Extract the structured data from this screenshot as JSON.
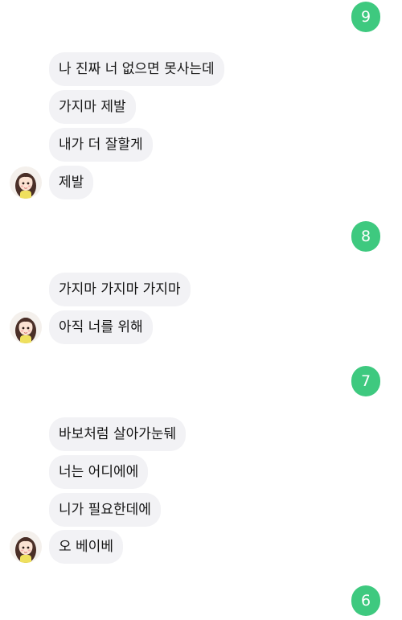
{
  "messages": [
    {
      "type": "sent",
      "text": "9"
    },
    {
      "type": "received",
      "text": "나 진짜 너 없으면 못사는데"
    },
    {
      "type": "received",
      "text": "가지마 제발"
    },
    {
      "type": "received",
      "text": "내가 더 잘할게"
    },
    {
      "type": "received",
      "text": "제발"
    },
    {
      "type": "sent",
      "text": "8"
    },
    {
      "type": "received",
      "text": "가지마 가지마 가지마"
    },
    {
      "type": "received",
      "text": "아직 너를 위해"
    },
    {
      "type": "sent",
      "text": "7"
    },
    {
      "type": "received",
      "text": "바보처럼 살아가눈뒈"
    },
    {
      "type": "received",
      "text": "너는 어디에에"
    },
    {
      "type": "received",
      "text": "니가 필요한데에"
    },
    {
      "type": "received",
      "text": "오 베이베"
    },
    {
      "type": "sent",
      "text": "6"
    }
  ],
  "colors": {
    "sent_bubble": "#3ec97f",
    "received_bubble": "#f2f2f5"
  },
  "icons": {
    "avatar": "profile-avatar-icon"
  }
}
